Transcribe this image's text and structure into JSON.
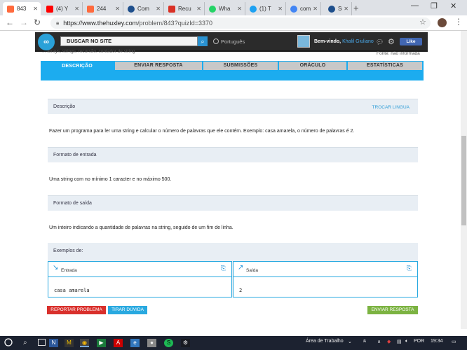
{
  "browser": {
    "tabs": [
      {
        "label": "843",
        "favicon_color": "#ff6a3d",
        "active": true
      },
      {
        "label": "(4) Y",
        "favicon_color": "#ff0000"
      },
      {
        "label": "244",
        "favicon_color": "#ff6a3d"
      },
      {
        "label": "Com",
        "favicon_color": "#1e4f8c"
      },
      {
        "label": "Recu",
        "favicon_color": "#d93025"
      },
      {
        "label": "Wha",
        "favicon_color": "#25d366"
      },
      {
        "label": "(1) T",
        "favicon_color": "#1da1f2"
      },
      {
        "label": "com",
        "favicon_color": "#4285f4"
      },
      {
        "label": "Som",
        "favicon_color": "#1e4f8c"
      }
    ],
    "new_tab_icon": "+",
    "window_controls": [
      "—",
      "❐",
      "✕"
    ],
    "url_host": "https://www.thehuxley.com",
    "url_path": "/problem/843?quizId=3370"
  },
  "site": {
    "search_placeholder": "BUSCAR NO SITE",
    "language": "Português",
    "welcome": "Bem-vindo,",
    "user_name": "Khalil Giuliano",
    "like_label": "Like",
    "breadcrumb": "... arrays, strings, recursão, contador de string",
    "fonte": "Fonte: não informada"
  },
  "tabs": [
    "DESCRIÇÃO",
    "ENVIAR RESPOSTA",
    "SUBMISSÕES",
    "ORÁCULO",
    "ESTATÍSTICAS"
  ],
  "content": {
    "descricao_label": "Descrição",
    "trocar_lingua": "TROCAR LINGUA",
    "descricao_text": "Fazer um programa para ler uma string e calcular o número de palavras que ele contém. Exemplo: casa amarela, o número de palavras é 2.",
    "entrada_label": "Formato de entrada",
    "entrada_text": "Uma string com no mínimo 1 caracter e no máximo 500.",
    "saida_label": "Formato de saída",
    "saida_text": "Um inteiro indicando a quantidade de palavras na string, seguido de um fim de linha.",
    "exemplos_label": "Exemplos de:",
    "entrada_col": "Entrada",
    "saida_col": "Saída",
    "example_input": "casa amarela",
    "example_output": "2"
  },
  "buttons": {
    "reportar": "REPORTAR PROBLEMA",
    "duvida": "TIRAR DÚVIDA",
    "enviar": "ENVIAR RESPOSTA"
  },
  "taskbar": {
    "desktop_label": "Área de Trabalho",
    "language": "POR",
    "time": "19:34",
    "apps": [
      "N",
      "M",
      "◉",
      "▶",
      "A",
      "e",
      "●",
      "S"
    ]
  }
}
